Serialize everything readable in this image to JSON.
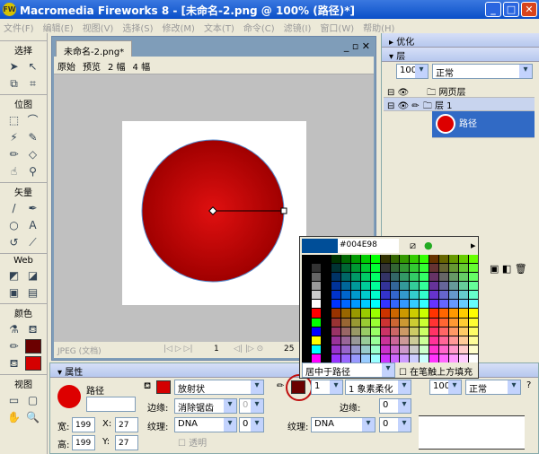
{
  "window": {
    "title": "Macromedia Fireworks 8 - [未命名-2.png @ 100% (路径)*]",
    "min": "_",
    "max": "□",
    "close": "✕"
  },
  "menu": [
    "文件(F)",
    "编辑(E)",
    "视图(V)",
    "选择(S)",
    "修改(M)",
    "文本(T)",
    "命令(C)",
    "滤镜(I)",
    "窗口(W)",
    "帮助(H)"
  ],
  "tools": {
    "sections": [
      "选择",
      "位图",
      "矢量",
      "Web",
      "颜色",
      "视图"
    ],
    "stroke_color": "#6b0000",
    "fill_color": "#d40000"
  },
  "document": {
    "tab": "未命名-2.png*",
    "views": [
      "原始",
      "预览",
      "2 幅",
      "4 幅"
    ],
    "status": "JPEG (文档)",
    "frame": "1",
    "zoom": "25"
  },
  "shape": {
    "fill_top": "#e01010",
    "fill_edge": "#a00000"
  },
  "panels": {
    "optimize": "优化",
    "layers": "层",
    "opacity": "100",
    "blend": "正常",
    "rows": [
      {
        "name": "网页层"
      },
      {
        "name": "层 1"
      },
      {
        "name": "路径"
      }
    ]
  },
  "picker": {
    "current": "#004E98",
    "current_color": "#004E98",
    "placement": "居中于路径",
    "fill_over_stroke": "在笔触上方填充"
  },
  "properties": {
    "title": "属性",
    "object": "路径",
    "width_label": "宽:",
    "height_label": "高:",
    "width": "199",
    "height": "199",
    "x_label": "X:",
    "y_label": "Y:",
    "x": "27",
    "y": "27",
    "fill_type": "放射状",
    "edge_label": "边缘:",
    "edge": "消除锯齿",
    "edge_amount": "0",
    "texture_label": "纹理:",
    "texture": "DNA",
    "texture_amount": "0",
    "transparent": "透明",
    "stroke_size": "1",
    "stroke_type": "1 象素柔化",
    "stroke_edge": "0",
    "stroke_texture": "DNA",
    "stroke_texture_amount": "0",
    "opacity": "100",
    "blend": "正常"
  }
}
